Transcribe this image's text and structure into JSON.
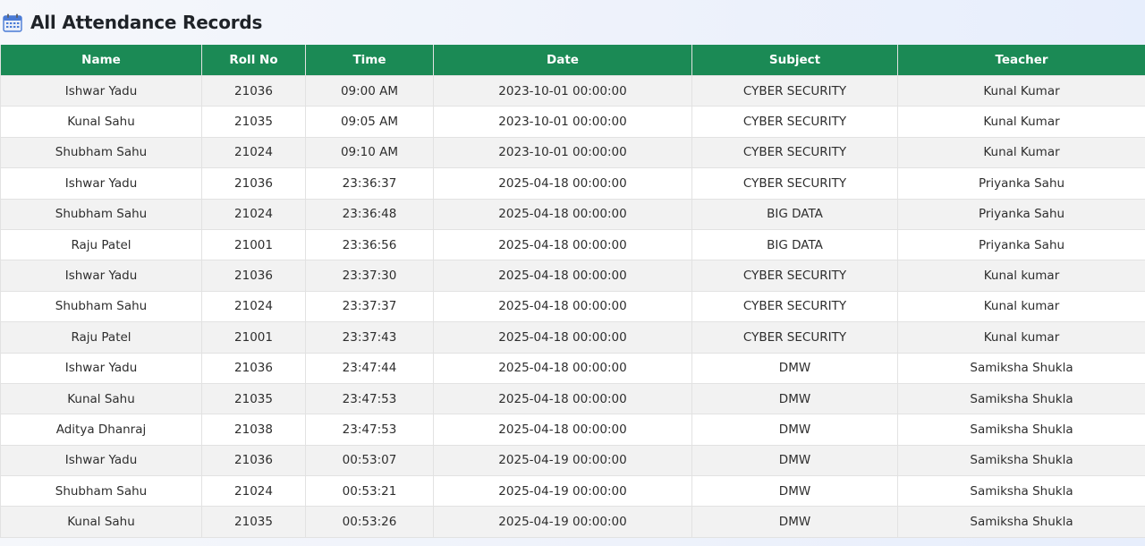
{
  "header": {
    "title": "All Attendance Records",
    "icon": "calendar-icon",
    "icon_color": "#4a7bd6"
  },
  "colors": {
    "header_bg": "#1b8a55",
    "row_alt": "#f2f2f2"
  },
  "table": {
    "columns": [
      "Name",
      "Roll No",
      "Time",
      "Date",
      "Subject",
      "Teacher"
    ],
    "rows": [
      [
        "Ishwar Yadu",
        "21036",
        "09:00 AM",
        "2023-10-01 00:00:00",
        "CYBER SECURITY",
        "Kunal Kumar"
      ],
      [
        "Kunal Sahu",
        "21035",
        "09:05 AM",
        "2023-10-01 00:00:00",
        "CYBER SECURITY",
        "Kunal Kumar"
      ],
      [
        "Shubham Sahu",
        "21024",
        "09:10 AM",
        "2023-10-01 00:00:00",
        "CYBER SECURITY",
        "Kunal Kumar"
      ],
      [
        "Ishwar Yadu",
        "21036",
        "23:36:37",
        "2025-04-18 00:00:00",
        "CYBER SECURITY",
        "Priyanka Sahu"
      ],
      [
        "Shubham Sahu",
        "21024",
        "23:36:48",
        "2025-04-18 00:00:00",
        "BIG DATA",
        "Priyanka Sahu"
      ],
      [
        "Raju Patel",
        "21001",
        "23:36:56",
        "2025-04-18 00:00:00",
        "BIG DATA",
        "Priyanka Sahu"
      ],
      [
        "Ishwar Yadu",
        "21036",
        "23:37:30",
        "2025-04-18 00:00:00",
        "CYBER SECURITY",
        "Kunal kumar"
      ],
      [
        "Shubham Sahu",
        "21024",
        "23:37:37",
        "2025-04-18 00:00:00",
        "CYBER SECURITY",
        "Kunal kumar"
      ],
      [
        "Raju Patel",
        "21001",
        "23:37:43",
        "2025-04-18 00:00:00",
        "CYBER SECURITY",
        "Kunal kumar"
      ],
      [
        "Ishwar Yadu",
        "21036",
        "23:47:44",
        "2025-04-18 00:00:00",
        "DMW",
        "Samiksha Shukla"
      ],
      [
        "Kunal Sahu",
        "21035",
        "23:47:53",
        "2025-04-18 00:00:00",
        "DMW",
        "Samiksha Shukla"
      ],
      [
        "Aditya Dhanraj",
        "21038",
        "23:47:53",
        "2025-04-18 00:00:00",
        "DMW",
        "Samiksha Shukla"
      ],
      [
        "Ishwar Yadu",
        "21036",
        "00:53:07",
        "2025-04-19 00:00:00",
        "DMW",
        "Samiksha Shukla"
      ],
      [
        "Shubham Sahu",
        "21024",
        "00:53:21",
        "2025-04-19 00:00:00",
        "DMW",
        "Samiksha Shukla"
      ],
      [
        "Kunal Sahu",
        "21035",
        "00:53:26",
        "2025-04-19 00:00:00",
        "DMW",
        "Samiksha Shukla"
      ]
    ]
  }
}
